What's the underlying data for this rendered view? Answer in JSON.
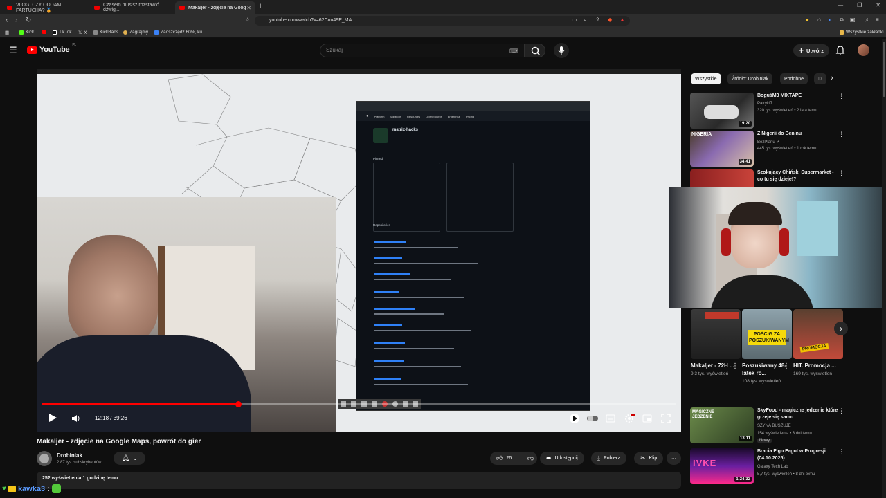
{
  "browser": {
    "tabs": [
      {
        "label": "VLOG: CZY ODDAM FARTUCHA? 🏅"
      },
      {
        "label": "Czasem musisz rozstawić dźwig..."
      },
      {
        "label": "Makaljer - zdjęcie na Google Ma..."
      }
    ],
    "url": "youtube.com/watch?v=62Cuu49E_MA",
    "bookmarks": [
      "Kick",
      "TikTok",
      "X",
      "KickBans",
      "Zagrajmy",
      "Zaoszczędź 60%, ku..."
    ],
    "bookmarks_right": "Wszystkie zakładki"
  },
  "header": {
    "logo": "YouTube",
    "region": "PL",
    "search_placeholder": "Szukaj",
    "create_label": "Utwórz"
  },
  "player": {
    "time": "12:18 / 39:26",
    "progress": 0.31,
    "overlay": {
      "repo_title": "matrix-hacks",
      "pinned": "Pinned",
      "repositories": "Repositories"
    }
  },
  "video": {
    "title": "Makaljer - zdjęcie na Google Maps, powrót do gier",
    "channel": "Drobiniak",
    "subscribers": "2,87 tys. subskrybentów",
    "likes": "26",
    "share": "Udostępnij",
    "download": "Pobierz",
    "clip": "Klip",
    "stats": "252 wyświetlenia  1 godzinę temu"
  },
  "chat": {
    "user": "kawka3",
    "sep": ":"
  },
  "sidebar": {
    "chips": [
      "Wszystkie",
      "Źródło: Drobiniak",
      "Podobne",
      "D"
    ],
    "videos": [
      {
        "title": "BoguśM3 MIXTAPE",
        "channel": "PatrykI7",
        "meta": "320 tys. wyświetleń • 2 lata temu",
        "duration": "19:20",
        "color": "#3b3b3b"
      },
      {
        "title": "Z Nigerii do Beninu",
        "channel": "BezPlanu",
        "meta": "445 tys. wyświetleń • 1 rok temu",
        "duration": "34:41",
        "color": "#6a5a7a"
      },
      {
        "title": "Szokujący Chiński Supermarket - co tu się dzieje!?",
        "channel": "",
        "meta": "",
        "duration": "",
        "color": "#7a2525"
      },
      {
        "title": "SkyFood - magiczne jedzenie które grzeje się samo",
        "channel": "SZYNA BUSZUJE",
        "meta": "154 wyświetlenia • 3 dni temu",
        "badge": "Nowy",
        "duration": "13:11",
        "color": "#4d6a3a"
      },
      {
        "title": "Bracia Figo Fagot w Progresji (04.10.2025)",
        "channel": "Galaxy Tech Lab",
        "meta": "5,7 tys. wyświetleń • 8 dni temu",
        "duration": "1:24:32",
        "color": "#3a1f5a"
      }
    ],
    "shorts": [
      {
        "title": "Makaljer - 72H ...",
        "views": "9,3 tys. wyświetleń",
        "color": "#2b2b2b",
        "overlay": ""
      },
      {
        "title": "Poszukiwany 48-latek ro...",
        "views": "108 tys. wyświetleń",
        "color": "#6b7d86",
        "overlay": "POŚCIG ZA POSZUKIWANYM"
      },
      {
        "title": "HIT. Promocja ...",
        "views": "169 tys. wyświetleń",
        "color": "#c24a3a",
        "overlay": "PROMOCJA"
      }
    ]
  }
}
